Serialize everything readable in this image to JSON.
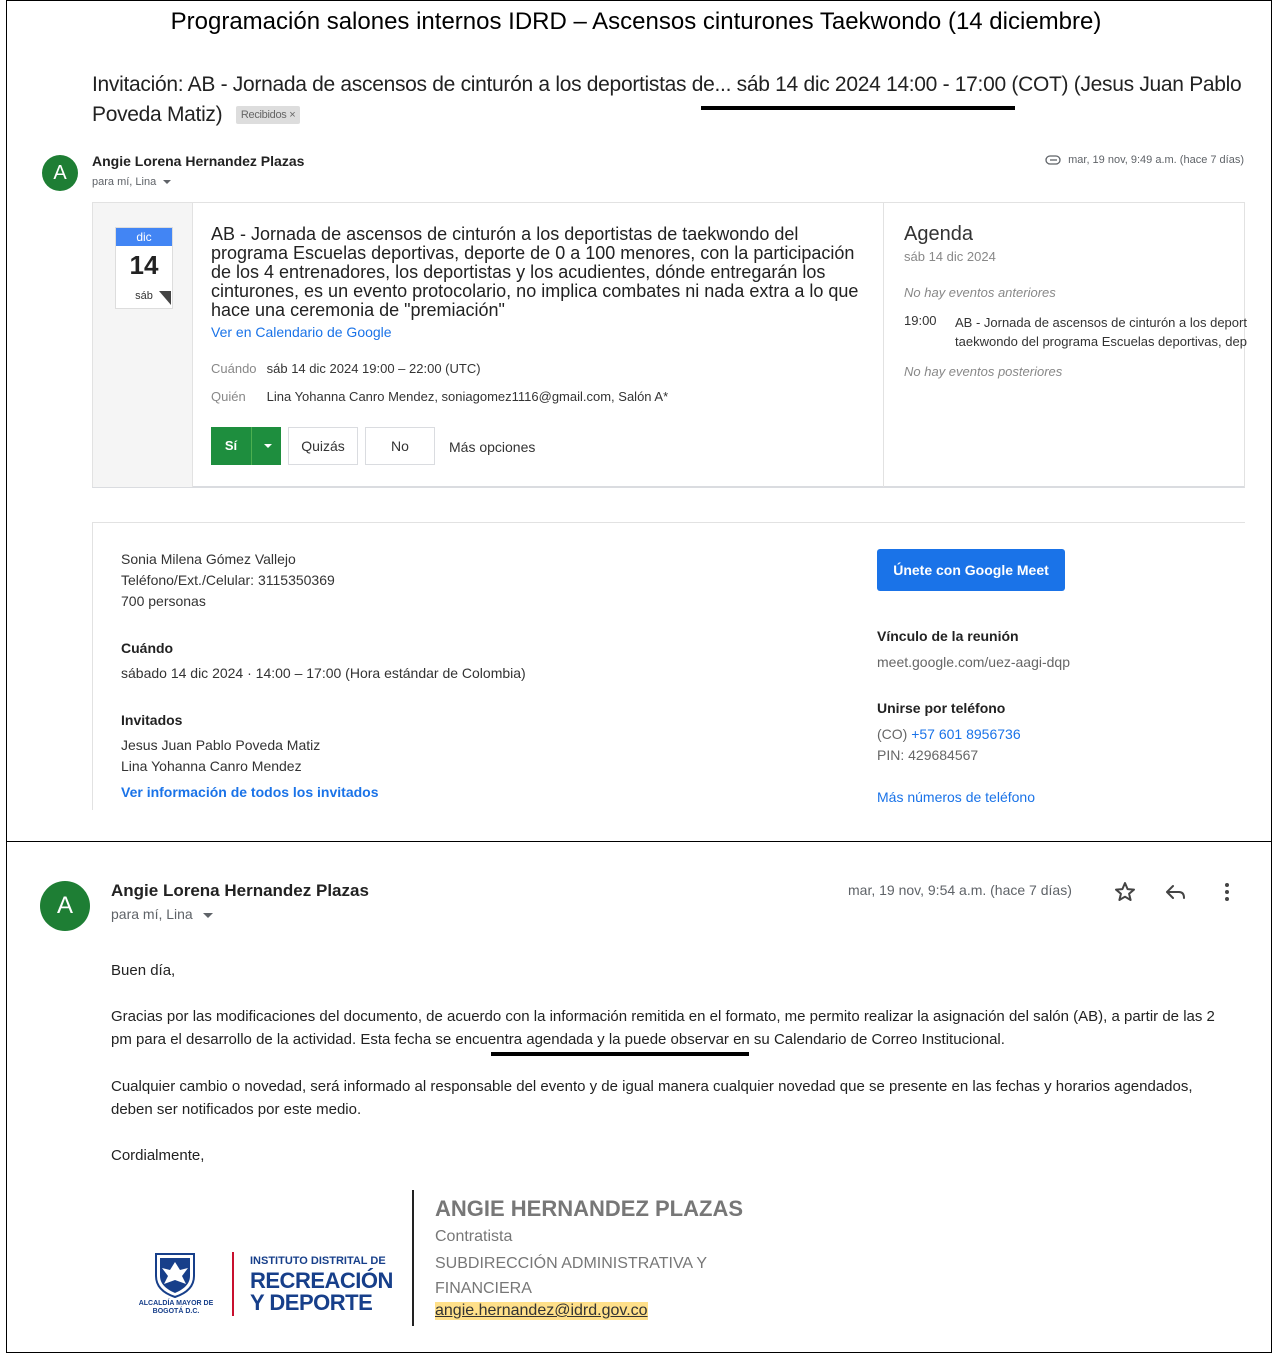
{
  "document": {
    "title": "Programación salones internos IDRD – Ascensos cinturones Taekwondo (14 diciembre)"
  },
  "email1": {
    "subject_prefix": "Invitación: AB - Jornada de ascensos de cinturón a los deportistas de...",
    "subject_date": "sáb 14 dic 2024 14:00 - 17:00 (COT)",
    "subject_suffix": "(Jesus Juan Pablo Poveda Matiz)",
    "label_chip": "Recibidos ×",
    "sender_initial": "A",
    "sender_name": "Angie Lorena Hernandez Plazas",
    "to_line": "para mí, Lina",
    "timestamp": "mar, 19 nov, 9:49 a.m. (hace 7 días)",
    "invite": {
      "month": "dic",
      "day": "14",
      "weekday": "sáb",
      "title": "AB - Jornada de ascensos de cinturón a los deportistas de taekwondo del programa Escuelas deportivas, deporte de 0 a 100 menores, con la participación de los 4 entrenadores, los deportistas y los acudientes, dónde entregarán los cinturones, es un evento protocolario, no implica combates ni nada extra a lo que hace una ceremonia de \"premiación\"",
      "gcal_link": "Ver en Calendario de Google",
      "when_label": "Cuándo",
      "when_value": "sáb 14 dic 2024 19:00 – 22:00 (UTC)",
      "who_label": "Quién",
      "who_value": "Lina Yohanna Canro Mendez, soniagomez1116@gmail.com, Salón A*",
      "rsvp_yes": "Sí",
      "rsvp_maybe": "Quizás",
      "rsvp_no": "No",
      "more_options": "Más opciones"
    },
    "agenda": {
      "title": "Agenda",
      "date": "sáb 14 dic 2024",
      "no_previous": "No hay eventos anteriores",
      "time": "19:00",
      "event_line1": "AB - Jornada de ascensos de cinturón a los deportist",
      "event_line2": "taekwondo del programa Escuelas deportivas, depor",
      "no_next": "No hay eventos posteriores"
    },
    "details": {
      "contact_name": "Sonia Milena Gómez Vallejo",
      "contact_phone": "Teléfono/Ext./Celular: 3115350369",
      "attendance": "700 personas",
      "when_heading": "Cuándo",
      "when_value": "sábado 14 dic 2024 · 14:00 – 17:00 (Hora estándar de Colombia)",
      "guests_heading": "Invitados",
      "guest1": "Jesus Juan Pablo Poveda Matiz",
      "guest2": "Lina Yohanna Canro Mendez",
      "guests_link": "Ver información de todos los invitados",
      "meet_button": "Únete con Google Meet",
      "meeting_link_heading": "Vínculo de la reunión",
      "meeting_link": "meet.google.com/uez-aagi-dqp",
      "phone_heading": "Unirse por teléfono",
      "phone_country": "(CO)",
      "phone_number": "+57 601 8956736",
      "pin": "PIN: 429684567",
      "more_numbers": "Más números de teléfono"
    }
  },
  "email2": {
    "sender_initial": "A",
    "sender_name": "Angie Lorena Hernandez Plazas",
    "to_line": "para mí, Lina",
    "timestamp": "mar, 19 nov, 9:54 a.m. (hace 7 días)",
    "greeting": "Buen día,",
    "p1_start": "Gracias por las modificaciones del documento, de acuerdo con la información remitida en el formato, me permito realizar la asignación del salón (AB), a partir de las 2 pm para el desarrollo de la actividad. ",
    "p1_emphasis": "Esta fecha se encuentra agendada",
    "p1_end": " y la puede observar en su Calendario de Correo Institucional.",
    "p2": "Cualquier cambio o novedad, será informado al responsable del evento y de igual manera cualquier novedad que se presente en las fechas y horarios agendados, deben ser notificados por este medio.",
    "closing": "Cordialmente,",
    "signature": {
      "name": "ANGIE HERNANDEZ PLAZAS",
      "role": "Contratista",
      "department": "SUBDIRECCIÓN ADMINISTRATIVA Y FINANCIERA",
      "email": "angie.hernandez@idrd.gov.co",
      "logo_small": "INSTITUTO DISTRITAL DE",
      "logo_line1": "RECREACIÓN",
      "logo_line2": "Y DEPORTE",
      "alcaldia": "ALCALDÍA MAYOR DE BOGOTÁ D.C."
    }
  },
  "colors": {
    "avatar": "#1e7e34",
    "accept": "#1e8e3e",
    "link": "#1a73e8",
    "brand": "#173f8a"
  }
}
